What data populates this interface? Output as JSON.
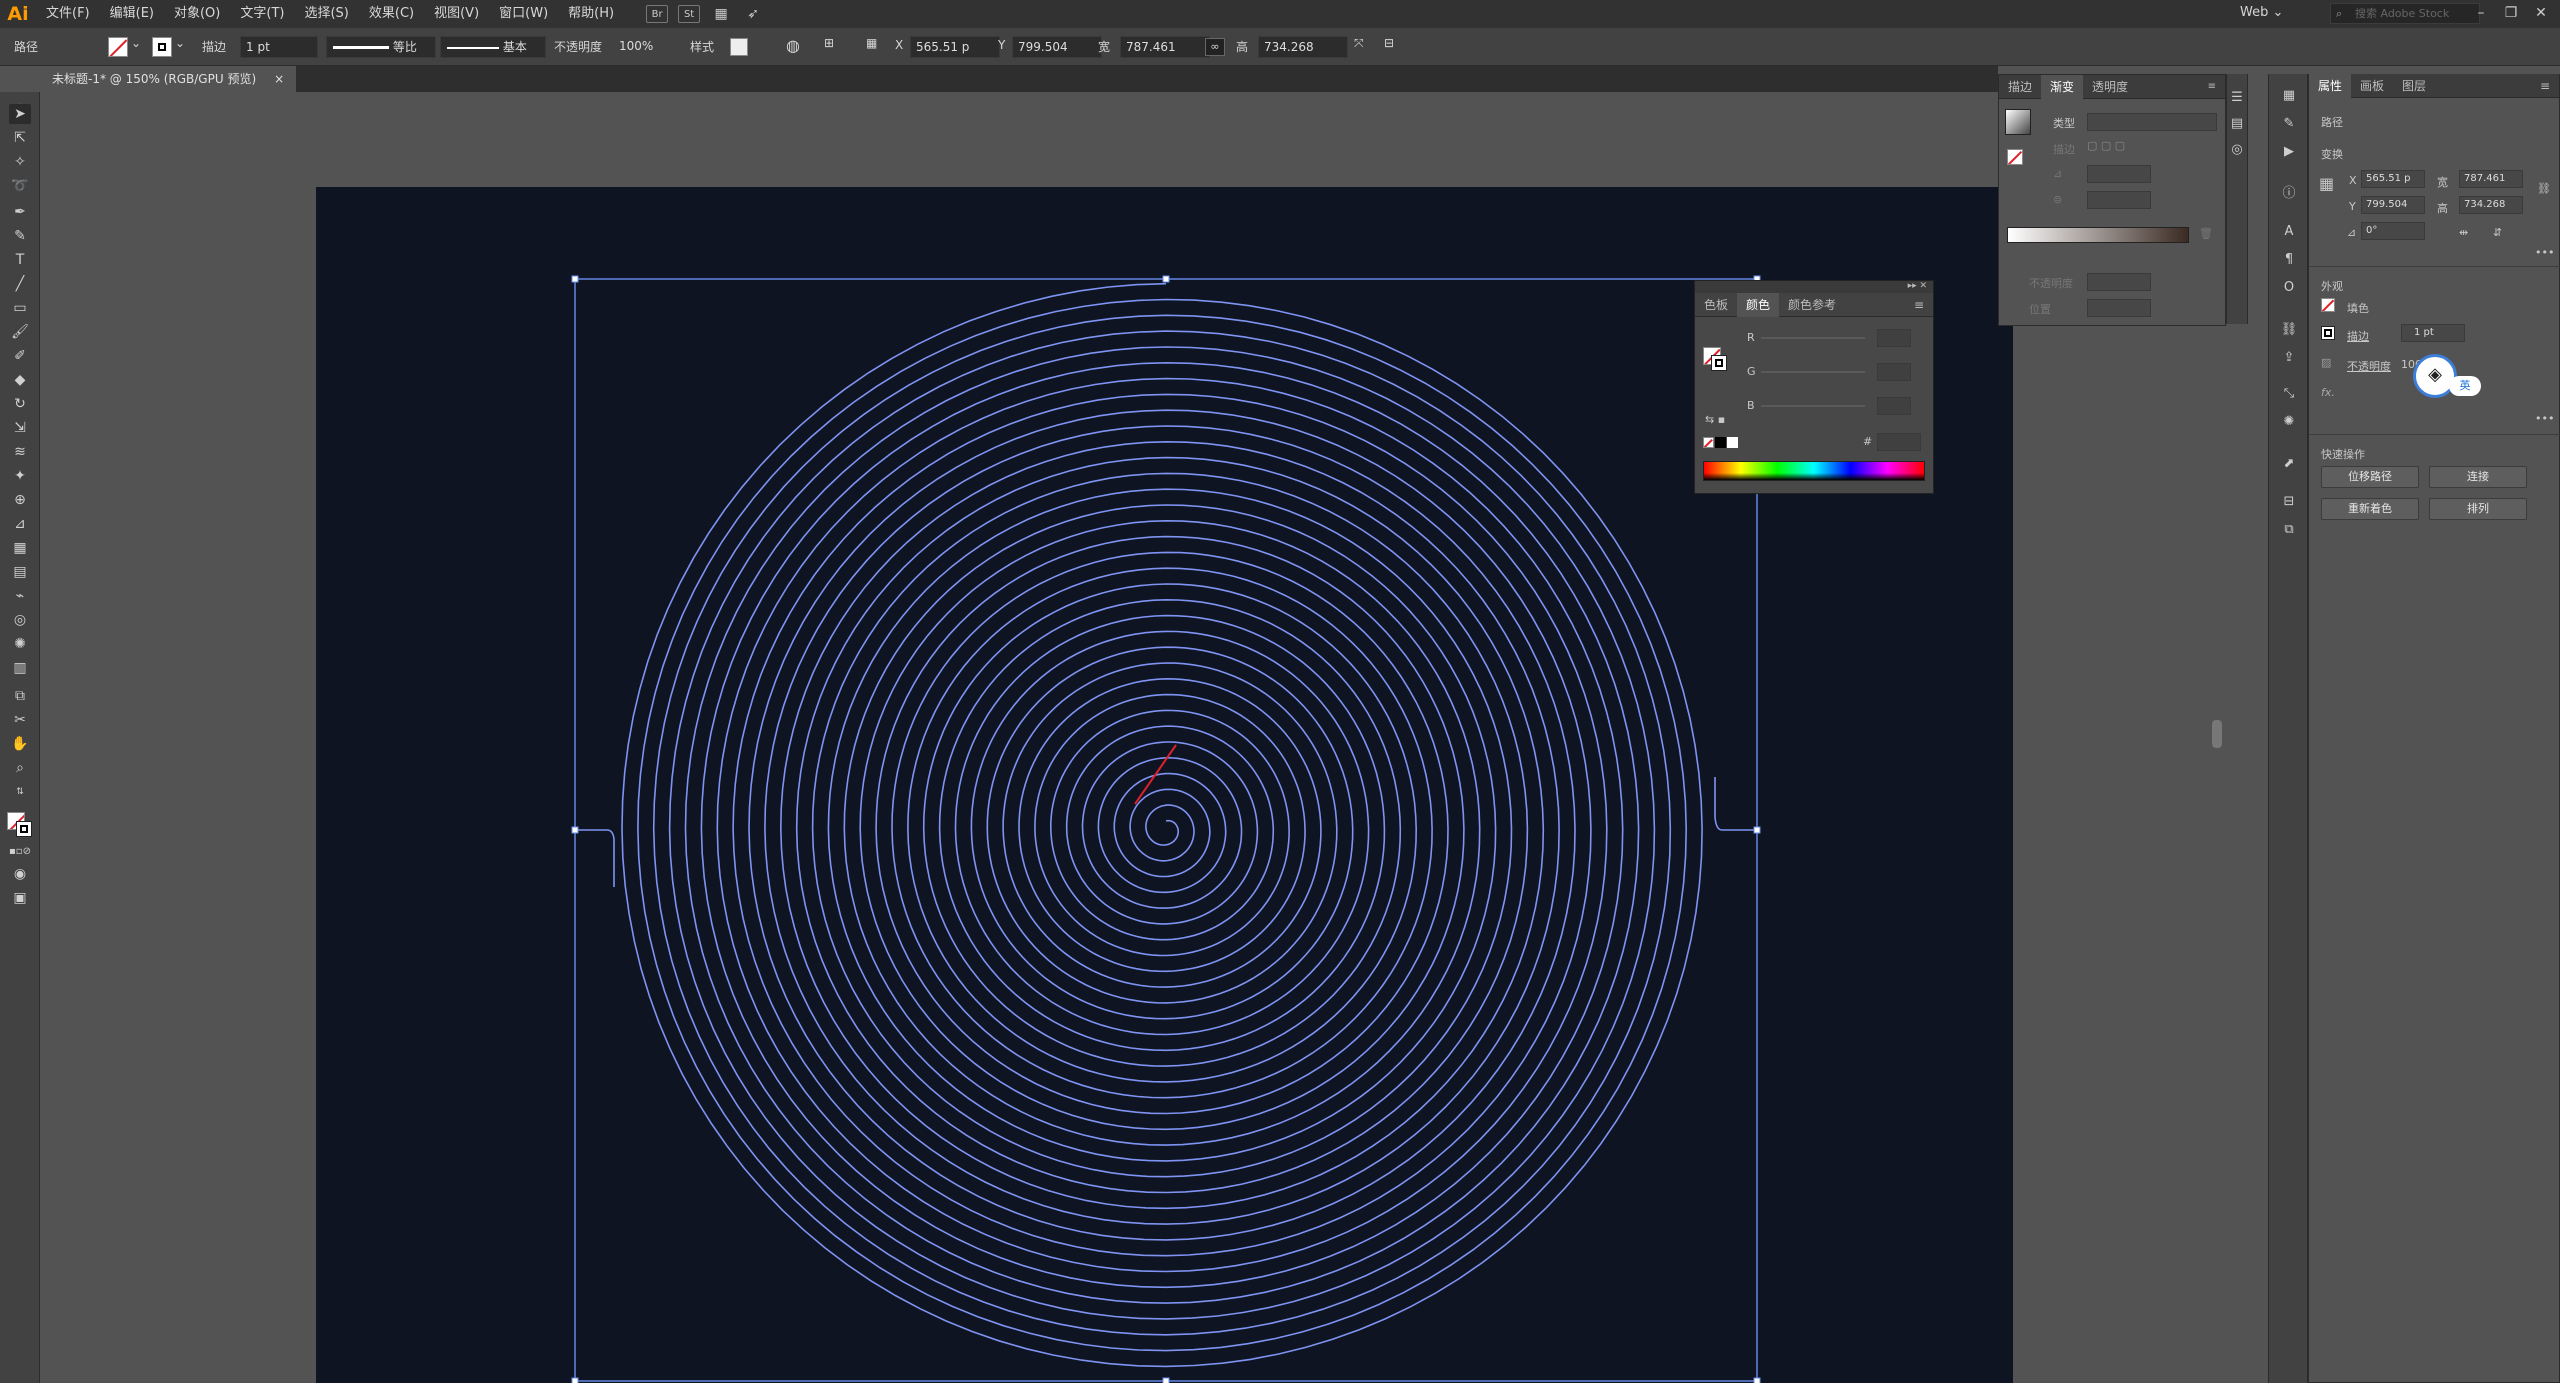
{
  "app": {
    "logo": "Ai"
  },
  "menu": [
    "文件(F)",
    "编辑(E)",
    "对象(O)",
    "文字(T)",
    "选择(S)",
    "效果(C)",
    "视图(V)",
    "窗口(W)",
    "帮助(H)"
  ],
  "menubar_buttons": [
    "Br",
    "St"
  ],
  "workspace": "Web",
  "stock_search_placeholder": "搜索 Adobe Stock",
  "control": {
    "selection": "路径",
    "stroke_label": "描边",
    "stroke_value": "1 pt",
    "stroke_profile": "等比",
    "brush": "基本",
    "opacity_label": "不透明度",
    "opacity_value": "100%",
    "style_label": "样式",
    "x_label": "X",
    "x_value": "565.51 p",
    "y_label": "Y",
    "y_value": "799.504",
    "w_label": "宽",
    "w_value": "787.461",
    "h_label": "高",
    "h_value": "734.268"
  },
  "document_tab": {
    "title": "未标题-1* @ 150% (RGB/GPU 预览)",
    "close": "×"
  },
  "gradient_panel": {
    "tabs": [
      "描边",
      "渐变",
      "透明度"
    ],
    "type_label": "类型",
    "stroke_label": "描边",
    "opacity_label": "不透明度",
    "position_label": "位置"
  },
  "color_panel": {
    "tabs": [
      "色板",
      "颜色",
      "颜色参考"
    ],
    "r_label": "R",
    "g_label": "G",
    "b_label": "B",
    "hex_label": "#"
  },
  "properties_panel": {
    "tabs": [
      "属性",
      "画板",
      "图层"
    ],
    "selection": "路径",
    "transform_label": "变换",
    "x_label": "X",
    "x_value": "565.51 p",
    "y_label": "Y",
    "y_value": "799.504",
    "w_label": "宽",
    "w_value": "787.461",
    "h_label": "高",
    "h_value": "734.268",
    "angle_label": "⊿",
    "angle_value": "0°",
    "appearance_label": "外观",
    "fill_label": "填色",
    "stroke_label": "描边",
    "stroke_value": "1 pt",
    "opacity_label": "不透明度",
    "opacity_value": "100%",
    "fx_label": "fx.",
    "quick_actions_label": "快速操作",
    "buttons": [
      "位移路径",
      "连接",
      "重新着色",
      "排列"
    ],
    "ime_badge": "英"
  },
  "colors": {
    "artboard": "#0e1421",
    "spiral_stroke": "#7f93f2",
    "selection_box": "#6a8ff0",
    "accent_red": "#e0202a"
  }
}
